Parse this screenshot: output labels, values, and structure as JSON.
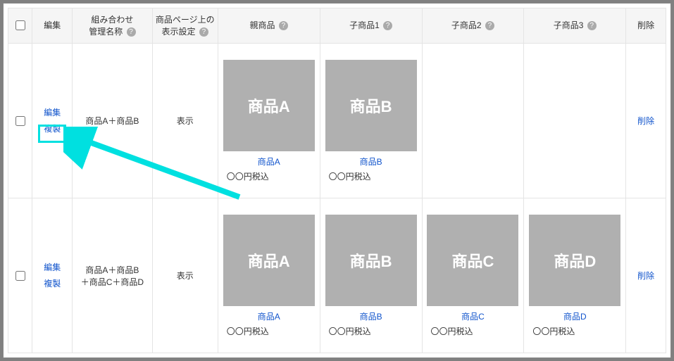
{
  "headers": {
    "edit": "編集",
    "name_l1": "組み合わせ",
    "name_l2": "管理名称",
    "display_l1": "商品ページ上の",
    "display_l2": "表示設定",
    "parent": "親商品",
    "child1": "子商品1",
    "child2": "子商品2",
    "child3": "子商品3",
    "delete": "削除"
  },
  "actions": {
    "edit": "編集",
    "copy": "複製",
    "delete": "削除"
  },
  "help_glyph": "?",
  "rows": [
    {
      "name": "商品A＋商品B",
      "display": "表示",
      "products": [
        {
          "thumb": "商品A",
          "title": "商品A",
          "price": "〇〇円税込"
        },
        {
          "thumb": "商品B",
          "title": "商品B",
          "price": "〇〇円税込"
        },
        null,
        null
      ]
    },
    {
      "name_l1": "商品A＋商品B",
      "name_l2": "＋商品C＋商品D",
      "display": "表示",
      "products": [
        {
          "thumb": "商品A",
          "title": "商品A",
          "price": "〇〇円税込"
        },
        {
          "thumb": "商品B",
          "title": "商品B",
          "price": "〇〇円税込"
        },
        {
          "thumb": "商品C",
          "title": "商品C",
          "price": "〇〇円税込"
        },
        {
          "thumb": "商品D",
          "title": "商品D",
          "price": "〇〇円税込"
        }
      ]
    }
  ]
}
